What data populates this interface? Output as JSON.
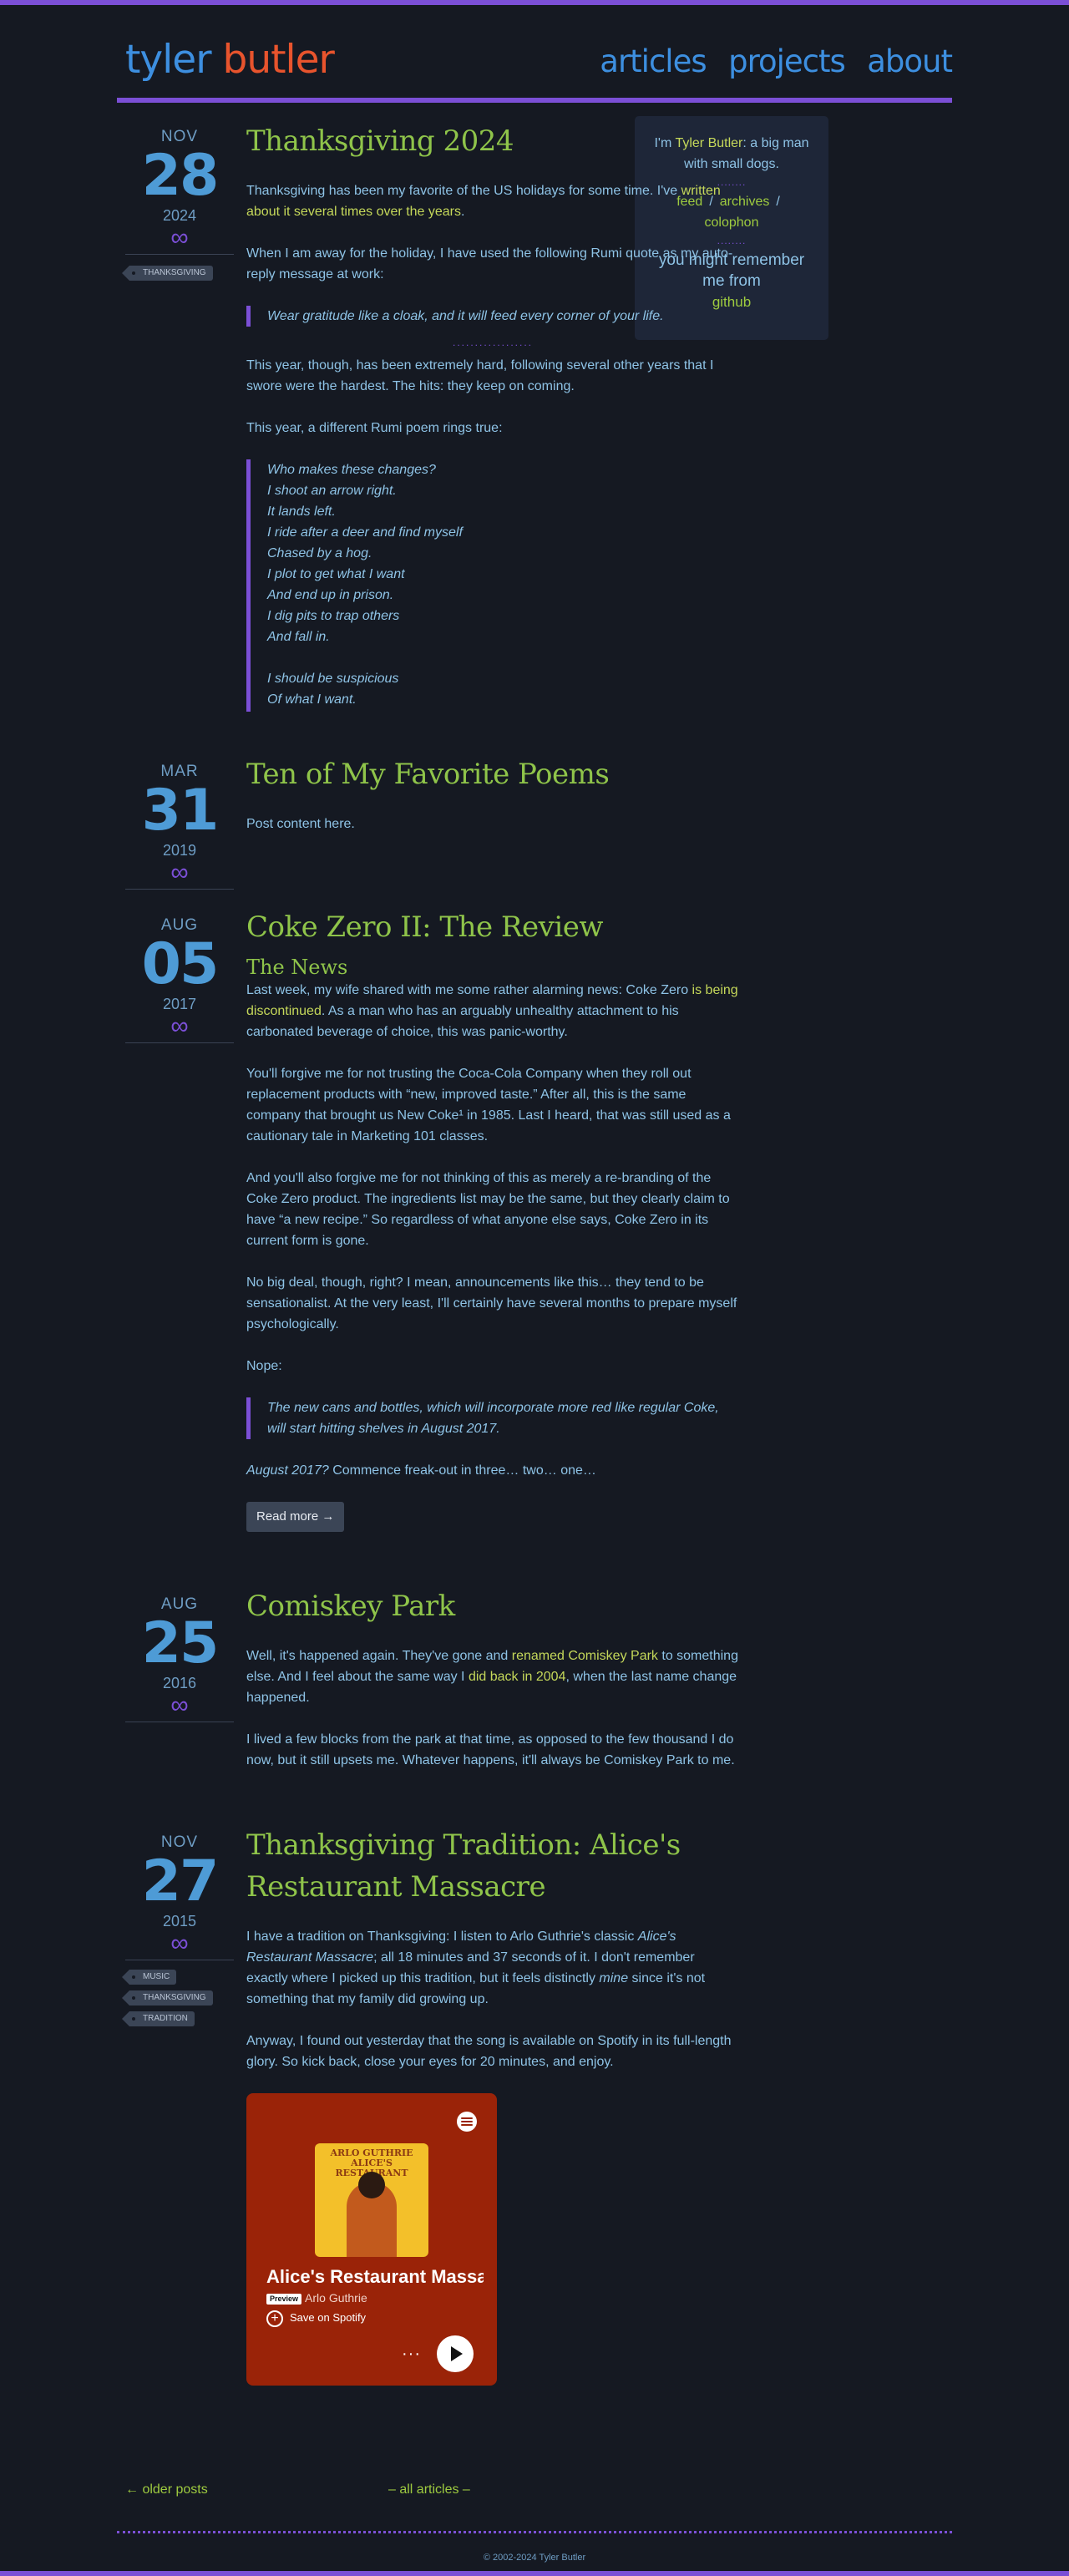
{
  "site": {
    "name_first": "tyler",
    "name_last": "butler",
    "nav": [
      "articles",
      "projects",
      "about"
    ]
  },
  "sidebar": {
    "intro_pre": "I'm ",
    "intro_name": "Tyler Butler",
    "intro_post": ": a big man with small dogs.",
    "dots": "........",
    "links": [
      "feed",
      "archives",
      "colophon"
    ],
    "sep": "/",
    "remember": "you might remember me from",
    "github": "github"
  },
  "posts": [
    {
      "month": "NOV",
      "day": "28",
      "year": "2024",
      "infinity": "∞",
      "tags": [
        "THANKSGIVING"
      ],
      "title": "Thanksgiving 2024",
      "p1_pre": "Thanksgiving has been my favorite of the US holidays for some time. I've ",
      "p1_link": "written about it several times over the years",
      "p1_post": ".",
      "p2": "When I am away for the holiday, I have used the following Rumi quote as my auto-reply message at work:",
      "quote1": "Wear gratitude like a cloak, and it will feed every corner of your life.",
      "dotsep": "..................",
      "p3": "This year, though, has been extremely hard, following several other years that I swore were the hardest. The hits: they keep on coming.",
      "p4": "This year, a different Rumi poem rings true:",
      "poem": [
        "Who makes these changes?",
        "I shoot an arrow right.",
        "It lands left.",
        "I ride after a deer and find myself",
        "Chased by a hog.",
        "I plot to get what I want",
        "And end up in prison.",
        "I dig pits to trap others",
        "And fall in.",
        "",
        "I should be suspicious",
        "Of what I want."
      ]
    },
    {
      "month": "MAR",
      "day": "31",
      "year": "2019",
      "infinity": "∞",
      "title": "Ten of My Favorite Poems",
      "p1": "Post content here."
    },
    {
      "month": "AUG",
      "day": "05",
      "year": "2017",
      "infinity": "∞",
      "title": "Coke Zero II: The Review",
      "subtitle": "The News",
      "p1_pre": "Last week, my wife shared with me some rather alarming news: Coke Zero ",
      "p1_link": "is being discontinued",
      "p1_post": ". As a man who has an arguably unhealthy attachment to his carbonated beverage of choice, this was panic-worthy.",
      "p2": "You'll forgive me for not trusting the Coca-Cola Company when they roll out replacement products with “new, improved taste.” After all, this is the same company that brought us New Coke¹ in 1985. Last I heard, that was still used as a cautionary tale in Marketing 101 classes.",
      "p3": "And you'll also forgive me for not thinking of this as merely a re-branding of the Coke Zero product. The ingredients list may be the same, but they clearly claim to have “a new recipe.” So regardless of what anyone else says, Coke Zero in its current form is gone.",
      "p4": "No big deal, though, right? I mean, announcements like this… they tend to be sensationalist. At the very least, I'll certainly have several months to prepare myself psychologically.",
      "p5": "Nope:",
      "quote": "The new cans and bottles, which will incorporate more red like regular Coke, will start hitting shelves in August 2017.",
      "p6_em": "August 2017?",
      "p6_rest": " Commence freak-out in three… two… one…",
      "readmore": "Read more →"
    },
    {
      "month": "AUG",
      "day": "25",
      "year": "2016",
      "infinity": "∞",
      "title": "Comiskey Park",
      "p1_a": "Well, it's happened again. They've gone and ",
      "p1_link1": "renamed Comiskey Park",
      "p1_b": " to something else. And I feel about the same way I ",
      "p1_link2": "did back in 2004",
      "p1_c": ", when the last name change happened.",
      "p2": "I lived a few blocks from the park at that time, as opposed to the few thousand I do now, but it still upsets me. Whatever happens, it'll always be Comiskey Park to me."
    },
    {
      "month": "NOV",
      "day": "27",
      "year": "2015",
      "infinity": "∞",
      "tags": [
        "MUSIC",
        "THANKSGIVING",
        "TRADITION"
      ],
      "title": "Thanksgiving Tradition: Alice's Restaurant Massacre",
      "p1_a": "I have a tradition on Thanksgiving: I listen to Arlo Guthrie's classic ",
      "p1_em": "Alice's Restaurant Massacre",
      "p1_b": "; all 18 minutes and 37 seconds of it. I don't remember exactly where I picked up this tradition, but it feels distinctly ",
      "p1_em2": "mine",
      "p1_c": " since it's not something that my family did growing up.",
      "p2": "Anyway, I found out yesterday that the song is available on Spotify in its full-length glory. So kick back, close your eyes for 20 minutes, and enjoy.",
      "spotify": {
        "cover_text": "ARLO GUTHRIE ALICE'S RESTAURANT",
        "track": "Alice's Restaurant Massacree",
        "badge": "Preview",
        "artist": "Arlo Guthrie",
        "save": "Save on Spotify",
        "more": "···"
      }
    }
  ],
  "pager": {
    "older": "← older posts",
    "all": "– all articles –"
  },
  "footer": {
    "copyright": "© 2002-2024 Tyler Butler"
  },
  "colors": {
    "background": "#151922",
    "accent": "#7b4fd6",
    "title_green": "#8fc44a",
    "link_yellow": "#c5d85a",
    "nav_blue": "#3d8fe0",
    "brand_orange": "#e8542d"
  }
}
